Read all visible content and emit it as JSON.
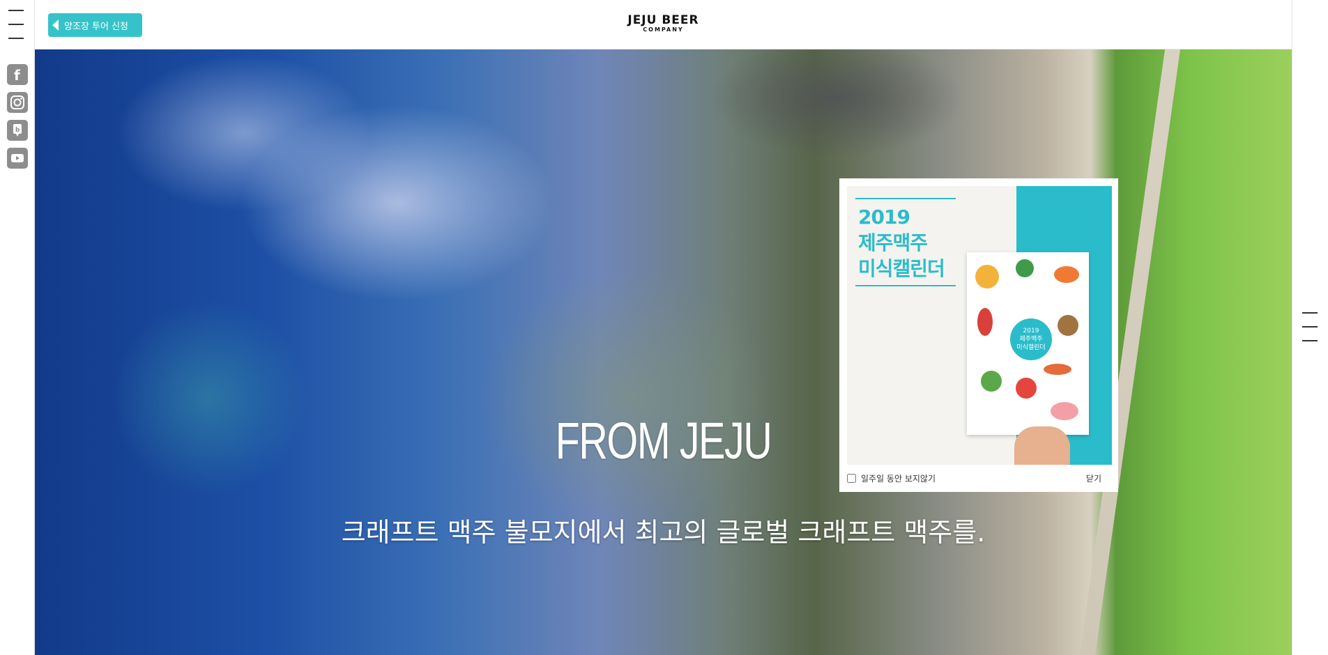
{
  "header": {
    "tour_button_label": "양조장 투어 신청",
    "logo_line1": "JEJU BEER",
    "logo_line2": "COMPANY"
  },
  "social_icons": [
    "facebook-icon",
    "instagram-icon",
    "blog-icon",
    "youtube-icon"
  ],
  "hero": {
    "title": "FROM JEJU",
    "subtitle": "크래프트 맥주 불모지에서 최고의 글로벌 크래프트 맥주를."
  },
  "popup": {
    "year": "2019",
    "line2": "제주맥주",
    "line3": "미식캘린더",
    "book_text1": "2019",
    "book_text2": "제주맥주",
    "book_text3": "미식캘린더",
    "dont_show_label": "일주일 동안 보지않기",
    "close_label": "닫기"
  },
  "colors": {
    "accent": "#35c3c9",
    "popup_teal": "#2bbccb",
    "social_gray": "#8d8d8d"
  }
}
